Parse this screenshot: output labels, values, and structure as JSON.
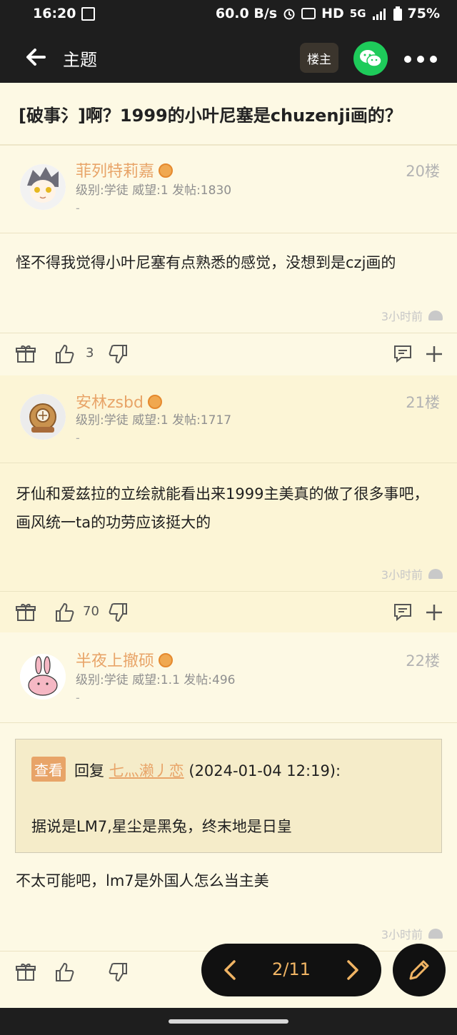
{
  "status_bar": {
    "time": "16:20",
    "speed": "60.0 B/s",
    "network": "HD",
    "signal": "5G",
    "battery": "75%"
  },
  "app_bar": {
    "title": "主题",
    "louzhu_label": "楼主"
  },
  "topic": {
    "title": "[破事氵]啊？1999的小叶尼塞是chuzenji画的？"
  },
  "posts": [
    {
      "username": "菲列特莉嘉",
      "meta": "级别:学徒 威望:1 发帖:1830",
      "dash": "-",
      "floor": "20楼",
      "content": "怪不得我觉得小叶尼塞有点熟悉的感觉，没想到是czj画的",
      "time": "3小时前",
      "likes": "3"
    },
    {
      "username": "安林zsbd",
      "meta": "级别:学徒 威望:1 发帖:1717",
      "dash": "-",
      "floor": "21楼",
      "content": "牙仙和爱兹拉的立绘就能看出来1999主美真的做了很多事吧，画风统一ta的功劳应该挺大的",
      "time": "3小时前",
      "likes": "70"
    },
    {
      "username": "半夜上撤硕",
      "meta": "级别:学徒 威望:1.1 发帖:496",
      "dash": "-",
      "floor": "22楼",
      "quote": {
        "view_label": "查看",
        "reply_prefix": "回复",
        "reply_user": "七灬濑丿恋",
        "reply_time": "(2024-01-04 12:19):",
        "text": "据说是LM7,星尘是黑兔，终末地是日皇"
      },
      "content": "不太可能吧，lm7是外国人怎么当主美",
      "time": "3小时前",
      "likes": ""
    }
  ],
  "pager": {
    "label": "2/11"
  },
  "colors": {
    "accent": "#e8a468",
    "background": "#fdf9e4",
    "alt_background": "#fcf5d6",
    "bar": "#1e1e1e"
  }
}
